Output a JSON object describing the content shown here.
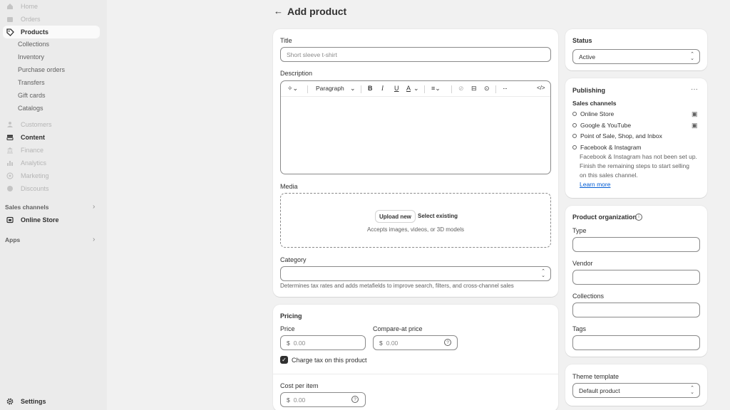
{
  "sidebar": {
    "items": [
      {
        "label": "Home",
        "icon": "home-icon"
      },
      {
        "label": "Orders",
        "icon": "inbox-icon"
      },
      {
        "label": "Products",
        "icon": "tag-icon"
      },
      {
        "label": "Customers",
        "icon": "person-icon"
      },
      {
        "label": "Content",
        "icon": "content-icon"
      },
      {
        "label": "Finance",
        "icon": "bank-icon"
      },
      {
        "label": "Analytics",
        "icon": "bar-chart-icon"
      },
      {
        "label": "Marketing",
        "icon": "target-icon"
      },
      {
        "label": "Discounts",
        "icon": "discount-icon"
      }
    ],
    "product_subitems": [
      "Collections",
      "Inventory",
      "Purchase orders",
      "Transfers",
      "Gift cards",
      "Catalogs"
    ],
    "sales_channels_label": "Sales channels",
    "online_store_label": "Online Store",
    "apps_label": "Apps",
    "settings_label": "Settings"
  },
  "header": {
    "back_icon": "arrow-left-icon",
    "title": "Add product"
  },
  "product": {
    "title_label": "Title",
    "title_placeholder": "Short sleeve t-shirt",
    "description_label": "Description",
    "toolbar": {
      "paragraph_label": "Paragraph",
      "bold": "B",
      "italic": "I",
      "underline": "U",
      "color": "A",
      "more": "···",
      "code": "</>"
    },
    "media_label": "Media",
    "upload_new": "Upload new",
    "select_existing": "Select existing",
    "media_hint": "Accepts images, videos, or 3D models",
    "category_label": "Category",
    "category_help": "Determines tax rates and adds metafields to improve search, filters, and cross-channel sales"
  },
  "pricing": {
    "heading": "Pricing",
    "price_label": "Price",
    "price_placeholder": "0.00",
    "compare_label": "Compare-at price",
    "compare_placeholder": "0.00",
    "currency": "$",
    "charge_tax_label": "Charge tax on this product",
    "charge_tax_checked": true,
    "cost_label": "Cost per item",
    "cost_placeholder": "0.00"
  },
  "status": {
    "label": "Status",
    "value": "Active"
  },
  "publishing": {
    "heading": "Publishing",
    "sales_channels_heading": "Sales channels",
    "channels": [
      "Online Store",
      "Google & YouTube",
      "Point of Sale, Shop, and Inbox",
      "Facebook & Instagram"
    ],
    "facebook_note": "Facebook & Instagram has not been set up. Finish the remaining steps to start selling on this sales channel.",
    "learn_more": "Learn more"
  },
  "organization": {
    "heading": "Product organization",
    "type_label": "Type",
    "vendor_label": "Vendor",
    "collections_label": "Collections",
    "tags_label": "Tags"
  },
  "theme": {
    "label": "Theme template",
    "value": "Default product"
  }
}
